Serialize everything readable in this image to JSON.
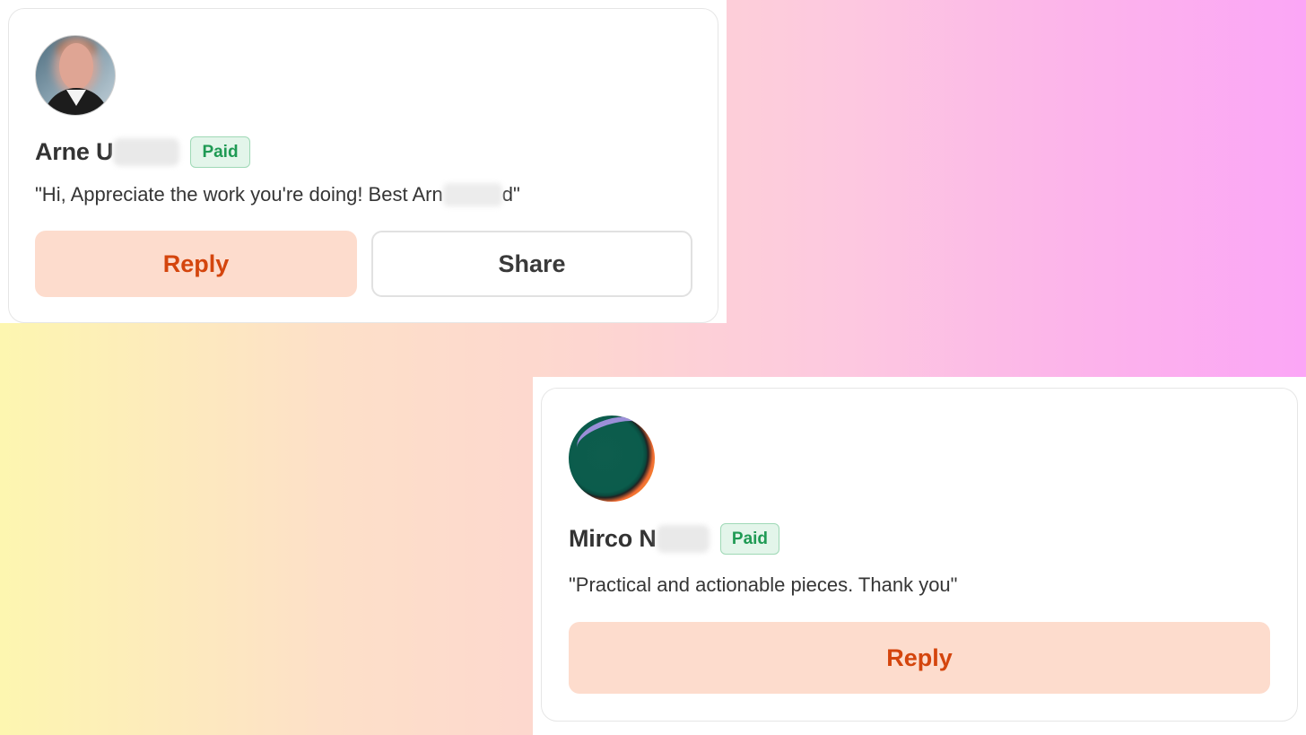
{
  "cards": [
    {
      "author_first": "Arne",
      "author_obscured": "U",
      "badge": "Paid",
      "message_start": "\"Hi, Appreciate the work you're doing! Best Arn",
      "message_end": "d\"",
      "reply_label": "Reply",
      "share_label": "Share",
      "avatar_icon": "person-photo-icon"
    },
    {
      "author_first": "Mirco",
      "author_obscured": "N",
      "badge": "Paid",
      "message": "\"Practical and actionable pieces. Thank you\"",
      "reply_label": "Reply",
      "avatar_icon": "abstract-circle-icon"
    }
  ],
  "colors": {
    "accent_reply_bg": "#fddccd",
    "accent_reply_text": "#d4450d",
    "badge_text": "#1f9a54",
    "badge_bg": "#e3f5ea"
  }
}
